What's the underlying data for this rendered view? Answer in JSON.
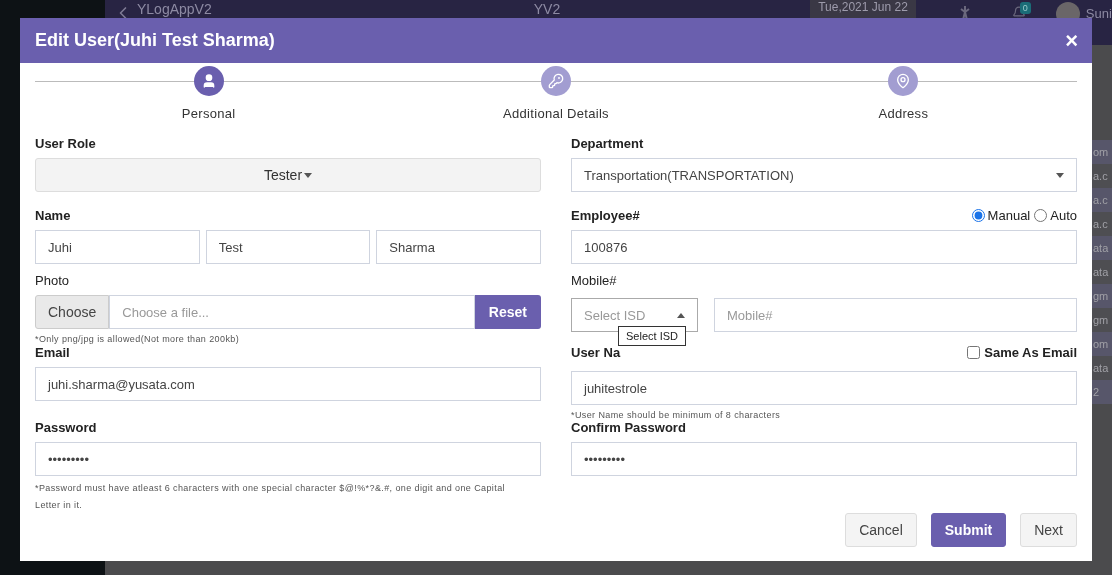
{
  "app_bar": {
    "app_name": "YLogAppV2",
    "center_title": "YV2",
    "date": "Tue,2021 Jun 22",
    "notification_count": "0",
    "user_name": "Suni"
  },
  "table_fragments": [
    "om",
    "a.c",
    "a.c",
    "a.c",
    "ata",
    "ata",
    "gm",
    "gm",
    "om",
    "ata",
    "2"
  ],
  "dialog": {
    "title": "Edit User(Juhi Test Sharma)",
    "close": "×",
    "steps": [
      {
        "label": "Personal",
        "selected": true
      },
      {
        "label": "Additional Details",
        "selected": false
      },
      {
        "label": "Address",
        "selected": false
      }
    ],
    "user_role": {
      "label": "User Role",
      "value": "Tester"
    },
    "department": {
      "label": "Department",
      "value": "Transportation(TRANSPORTATION)"
    },
    "name": {
      "label": "Name",
      "first": "Juhi",
      "middle": "Test",
      "last": "Sharma"
    },
    "employee": {
      "label": "Employee#",
      "value": "100876",
      "modes": [
        {
          "label": "Manual",
          "selected": true
        },
        {
          "label": "Auto",
          "selected": false
        }
      ]
    },
    "photo": {
      "label": "Photo",
      "choose": "Choose",
      "placeholder": "Choose a file...",
      "reset": "Reset",
      "hint": "*Only png/jpg is allowed(Not more than 200kb)"
    },
    "mobile": {
      "label": "Mobile#",
      "isd_placeholder": "Select ISD",
      "isd_expanded": true,
      "tooltip": "Select ISD",
      "placeholder": "Mobile#"
    },
    "email": {
      "label": "Email",
      "value": "juhi.sharma@yusata.com"
    },
    "user_name": {
      "label": "User Na",
      "value": "juhitestrole",
      "same_as_email": {
        "label": "Same As Email",
        "checked": false
      },
      "hint": "*User Name should be minimum of 8 characters"
    },
    "password": {
      "label": "Password",
      "value": "•••••••••",
      "hint": "*Password must have atleast 6 characters with one special character $@!%*?&.#, one digit and one Capital Letter in it."
    },
    "confirm_password": {
      "label": "Confirm Password",
      "value": "•••••••••"
    },
    "buttons": [
      {
        "label": "Cancel",
        "kind": "secondary"
      },
      {
        "label": "Submit",
        "kind": "primary"
      },
      {
        "label": "Next",
        "kind": "secondary"
      }
    ]
  }
}
